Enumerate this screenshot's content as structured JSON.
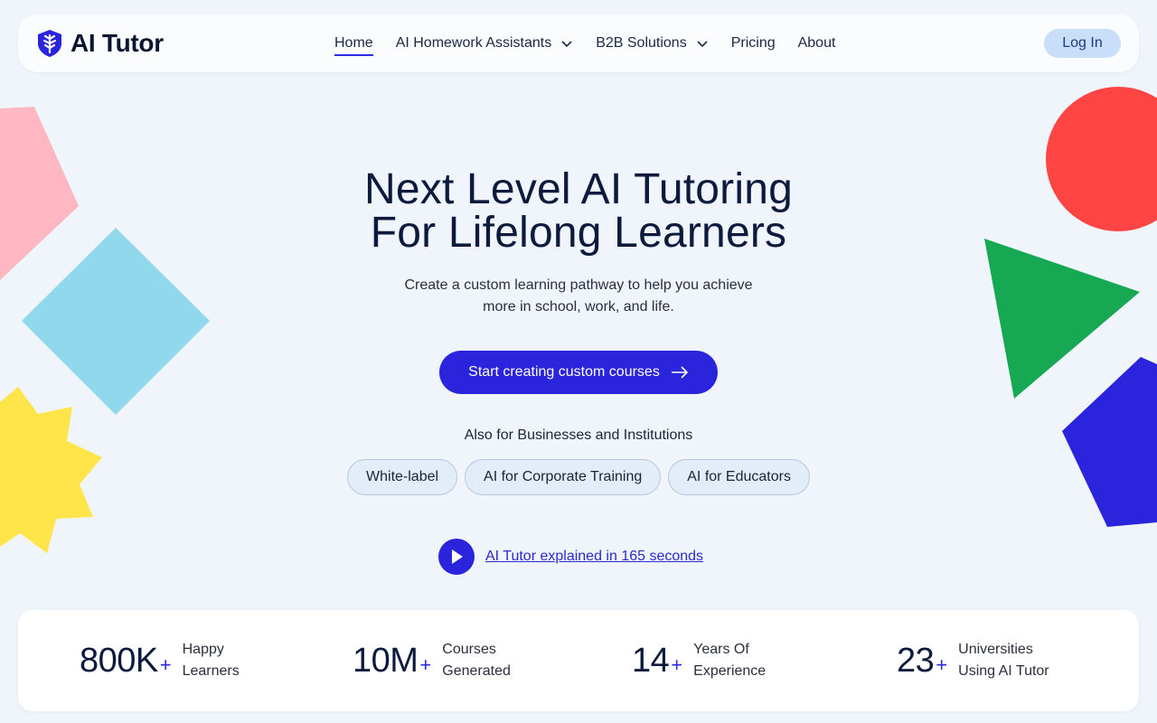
{
  "brand": {
    "name": "AI Tutor",
    "logo_icon": "shield-leaf-icon"
  },
  "nav": {
    "links": [
      {
        "label": "Home",
        "active": true,
        "dropdown": false
      },
      {
        "label": "AI Homework Assistants",
        "active": false,
        "dropdown": true
      },
      {
        "label": "B2B Solutions",
        "active": false,
        "dropdown": true
      },
      {
        "label": "Pricing",
        "active": false,
        "dropdown": false
      },
      {
        "label": "About",
        "active": false,
        "dropdown": false
      }
    ],
    "login_label": "Log In"
  },
  "hero": {
    "title_line1": "Next Level AI Tutoring",
    "title_line2": "For Lifelong Learners",
    "subtitle": "Create a custom learning pathway to help you achieve more in school, work, and life.",
    "cta_label": "Start creating custom courses",
    "cta_icon": "arrow-right-icon"
  },
  "business": {
    "heading": "Also for Businesses and Institutions",
    "pills": [
      "White-label",
      "AI for Corporate Training",
      "AI for Educators"
    ]
  },
  "video": {
    "label": "AI Tutor explained in 165 seconds",
    "icon": "play-icon"
  },
  "stats": [
    {
      "number": "800K",
      "suffix": "+",
      "label_line1": "Happy",
      "label_line2": "Learners"
    },
    {
      "number": "10M",
      "suffix": "+",
      "label_line1": "Courses",
      "label_line2": "Generated"
    },
    {
      "number": "14",
      "suffix": "+",
      "label_line1": "Years Of",
      "label_line2": "Experience"
    },
    {
      "number": "23",
      "suffix": "+",
      "label_line1": "Universities",
      "label_line2": "Using AI Tutor"
    }
  ],
  "colors": {
    "accent": "#2a24dc",
    "background": "#f0f5fc",
    "shape_pink": "#ffb8c2",
    "shape_cyan": "#91d8ec",
    "shape_yellow": "#ffe44a",
    "shape_red": "#ff4444",
    "shape_green": "#17a853",
    "shape_blue": "#2a24dc"
  }
}
